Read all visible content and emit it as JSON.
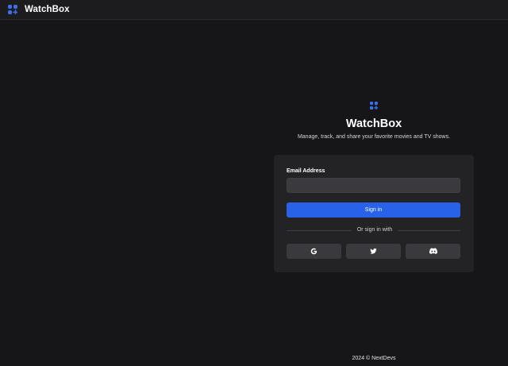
{
  "header": {
    "brand": "WatchBox",
    "logo_icon": "grid-plus-icon"
  },
  "hero": {
    "logo_icon": "grid-plus-icon",
    "title": "WatchBox",
    "subtitle": "Manage, track, and share your favorite movies and TV shows."
  },
  "form": {
    "email_label": "Email Address",
    "email_value": "",
    "email_placeholder": "",
    "signin_label": "Sign in",
    "divider_text": "Or sign in with",
    "social": [
      {
        "name": "google",
        "icon": "google-icon"
      },
      {
        "name": "twitter",
        "icon": "twitter-icon"
      },
      {
        "name": "discord",
        "icon": "discord-icon"
      }
    ]
  },
  "footer": {
    "text": "2024 © NextDevs"
  },
  "colors": {
    "accent": "#2862e8",
    "background": "#161618",
    "card": "#232326",
    "input": "#3a3a3e"
  }
}
